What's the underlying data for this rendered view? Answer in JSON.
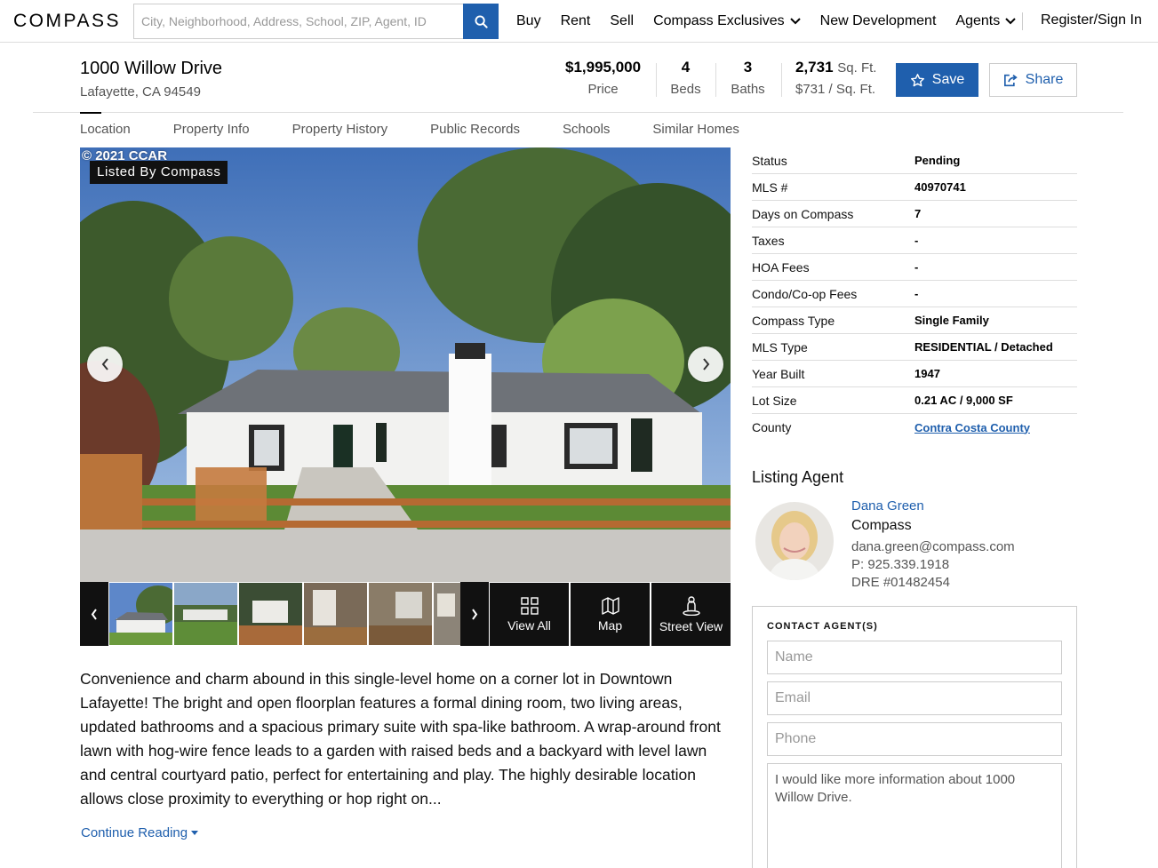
{
  "nav": {
    "logo": "COMPASS",
    "search_placeholder": "City, Neighborhood, Address, School, ZIP, Agent, ID",
    "items": [
      "Buy",
      "Rent",
      "Sell",
      "Compass Exclusives",
      "New Development",
      "Agents"
    ],
    "signin": "Register/Sign In"
  },
  "listing": {
    "address": "1000 Willow Drive",
    "city_line": "Lafayette, CA 94549",
    "price": "$1,995,000",
    "price_label": "Price",
    "beds": "4",
    "beds_label": "Beds",
    "baths": "3",
    "baths_label": "Baths",
    "sqft": "2,731",
    "sqft_unit": "Sq. Ft.",
    "price_per_sqft": "$731 / Sq. Ft."
  },
  "actions": {
    "save": "Save",
    "share": "Share"
  },
  "tabs": [
    "Location",
    "Property Info",
    "Property History",
    "Public Records",
    "Schools",
    "Similar Homes"
  ],
  "photo": {
    "copyright": "© 2021 CCAR",
    "badge": "Listed By Compass",
    "tools": [
      "View All",
      "Map",
      "Street View"
    ]
  },
  "description": "Convenience and charm abound in this single-level home on a corner lot in Downtown Lafayette! The bright and open floorplan features a formal dining room, two living areas, updated bathrooms and a spacious primary suite with spa-like bathroom. A wrap-around front lawn with hog-wire fence leads to a garden with raised beds and a backyard with level lawn and central courtyard patio, perfect for entertaining and play. The highly desirable location allows close proximity to everything or hop right on...",
  "continue_reading": "Continue Reading",
  "details": [
    {
      "label": "Status",
      "value": "Pending"
    },
    {
      "label": "MLS #",
      "value": "40970741"
    },
    {
      "label": "Days on Compass",
      "value": "7"
    },
    {
      "label": "Taxes",
      "value": "-"
    },
    {
      "label": "HOA Fees",
      "value": "-"
    },
    {
      "label": "Condo/Co-op Fees",
      "value": "-"
    },
    {
      "label": "Compass Type",
      "value": "Single Family"
    },
    {
      "label": "MLS Type",
      "value": "RESIDENTIAL / Detached"
    },
    {
      "label": "Year Built",
      "value": "1947"
    },
    {
      "label": "Lot Size",
      "value": "0.21 AC / 9,000 SF"
    },
    {
      "label": "County",
      "value": "Contra Costa County"
    }
  ],
  "agent": {
    "heading": "Listing Agent",
    "name": "Dana Green",
    "company": "Compass",
    "email": "dana.green@compass.com",
    "phone": "P: 925.339.1918",
    "dre": "DRE #01482454"
  },
  "contact": {
    "title": "CONTACT AGENT(S)",
    "name_placeholder": "Name",
    "email_placeholder": "Email",
    "phone_placeholder": "Phone",
    "message": "I would like more information about 1000 Willow Drive."
  },
  "colors": {
    "accent": "#1f5fad"
  }
}
